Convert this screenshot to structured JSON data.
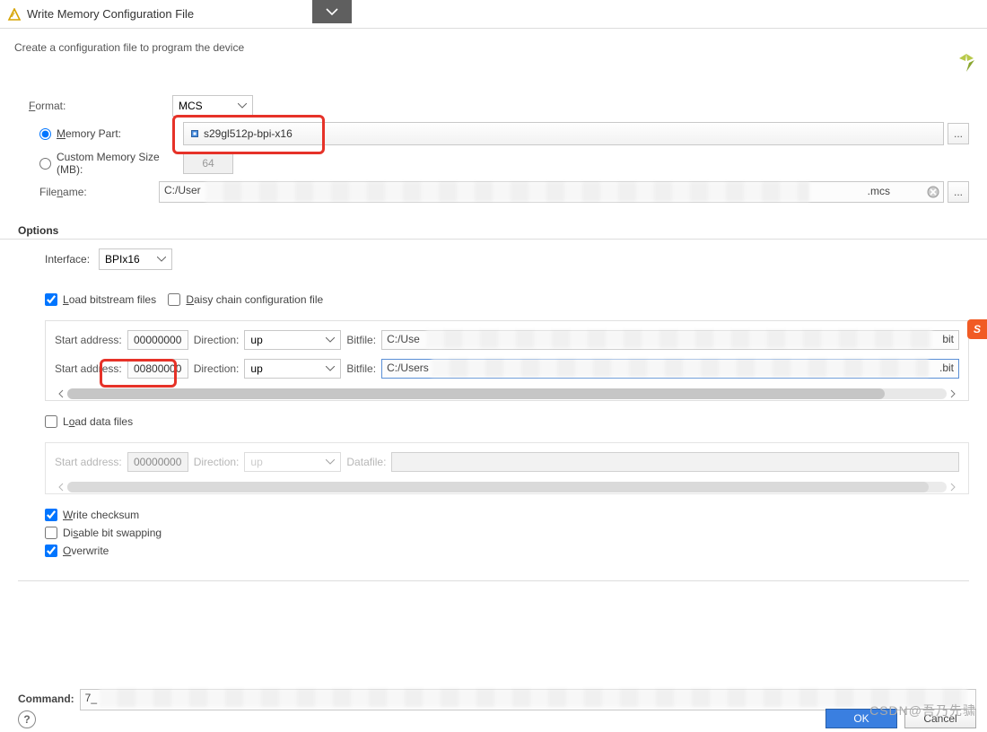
{
  "window": {
    "title": "Write Memory Configuration File",
    "subtitle": "Create a configuration file to program the device"
  },
  "form": {
    "format_label": "Format:",
    "format_value": "MCS",
    "memory_part_label": "Memory Part:",
    "memory_part_value": "s29gl512p-bpi-x16",
    "custom_mem_label": "Custom Memory Size (MB):",
    "custom_mem_value": "64",
    "filename_label": "Filename:",
    "filename_prefix": "C:/User",
    "filename_suffix": ".mcs"
  },
  "options": {
    "section": "Options",
    "interface_label": "Interface:",
    "interface_value": "BPIx16",
    "load_bitstream_label": "Load bitstream files",
    "daisy_label": "Daisy chain configuration file",
    "rows": [
      {
        "addr_label": "Start address:",
        "addr": "00000000",
        "dir_label": "Direction:",
        "dir": "up",
        "file_label": "Bitfile:",
        "file_prefix": "C:/Use",
        "file_suffix": "bit"
      },
      {
        "addr_label": "Start address:",
        "addr": "00800000",
        "dir_label": "Direction:",
        "dir": "up",
        "file_label": "Bitfile:",
        "file_prefix": "C:/Users",
        "file_suffix": ".bit"
      }
    ],
    "load_data_label": "Load data files",
    "data_row": {
      "addr_label": "Start address:",
      "addr_ph": "00000000",
      "dir_label": "Direction:",
      "dir": "up",
      "file_label": "Datafile:"
    },
    "write_checksum": "Write checksum",
    "disable_bitswap": "Disable bit swapping",
    "overwrite": "Overwrite"
  },
  "command": {
    "label": "Command:",
    "value": "7_"
  },
  "footer": {
    "ok": "OK",
    "cancel": "Cancel",
    "help": "?"
  },
  "watermark": "CSDN@吾乃先骕",
  "ellipsis": "..."
}
